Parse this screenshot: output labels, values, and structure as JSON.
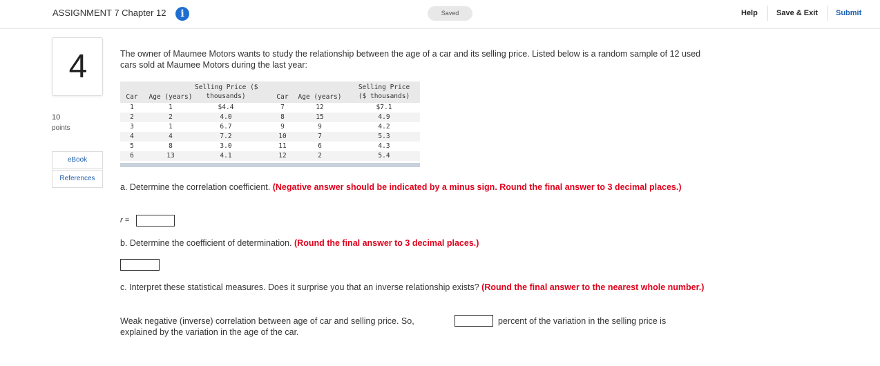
{
  "header": {
    "title": "ASSIGNMENT 7 Chapter 12",
    "saved_label": "Saved",
    "help_label": "Help",
    "save_exit_label": "Save & Exit",
    "submit_label": "Submit",
    "info_icon": "i"
  },
  "question": {
    "number": "4",
    "points_value": "10",
    "points_label": "points",
    "ebook_label": "eBook",
    "references_label": "References",
    "intro": "The owner of Maumee Motors wants to study the relationship between the age of a car and its selling price. Listed below is a random sample of 12 used cars sold at Maumee Motors during the last year:"
  },
  "table": {
    "headers": {
      "car": "Car",
      "age": "Age (years)",
      "price_left": "Selling Price ($\nthousands)",
      "car2": "Car",
      "age2": "Age (years)",
      "price_right": "Selling Price\n($ thousands)"
    },
    "rows": [
      {
        "car": "1",
        "age": "1",
        "price": "$4.4",
        "car2": "7",
        "age2": "12",
        "price2": "$7.1"
      },
      {
        "car": "2",
        "age": "2",
        "price": "4.0",
        "car2": "8",
        "age2": "15",
        "price2": "4.9"
      },
      {
        "car": "3",
        "age": "1",
        "price": "6.7",
        "car2": "9",
        "age2": "9",
        "price2": "4.2"
      },
      {
        "car": "4",
        "age": "4",
        "price": "7.2",
        "car2": "10",
        "age2": "7",
        "price2": "5.3"
      },
      {
        "car": "5",
        "age": "8",
        "price": "3.0",
        "car2": "11",
        "age2": "6",
        "price2": "4.3"
      },
      {
        "car": "6",
        "age": "13",
        "price": "4.1",
        "car2": "12",
        "age2": "2",
        "price2": "5.4"
      }
    ]
  },
  "part_a": {
    "label": "a. Determine the correlation coefficient. ",
    "instruction": "(Negative answer should be indicated by a minus sign. Round the final answer to 3 decimal places.)",
    "r_label": "r =",
    "value": ""
  },
  "part_b": {
    "label": "b. Determine the coefficient of determination. ",
    "instruction": "(Round the final answer to 3 decimal places.)",
    "value": ""
  },
  "part_c": {
    "label": "c. Interpret these statistical measures. Does it surprise you that an inverse relationship exists? ",
    "instruction": "(Round the final answer to the nearest whole number.)",
    "sentence_before": "Weak negative (inverse) correlation between age of car and selling price. So,",
    "sentence_after": "percent of the variation in the selling price is",
    "sentence_line2": "explained by the variation in the age of the car.",
    "value": ""
  }
}
